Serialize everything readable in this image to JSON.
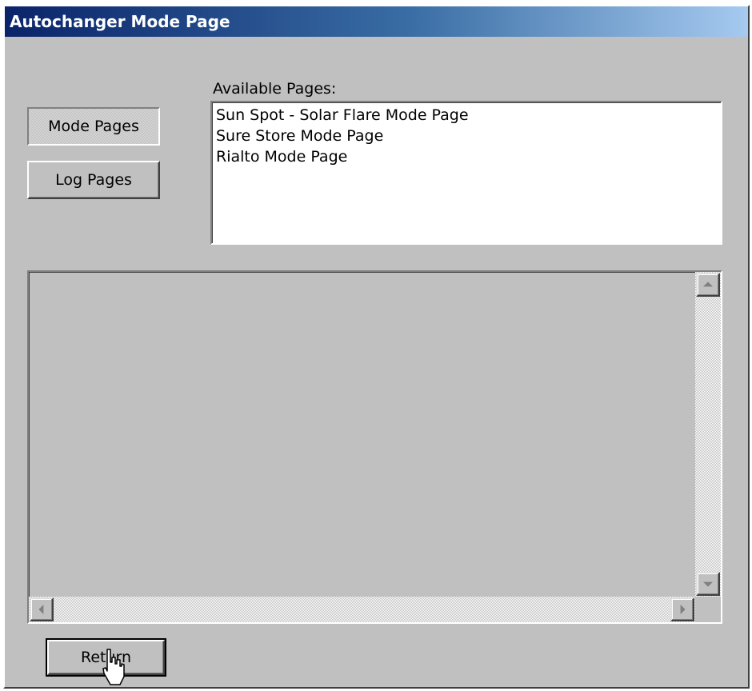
{
  "window": {
    "title": "Autochanger Mode Page"
  },
  "nav": {
    "mode_pages_label": "Mode Pages",
    "log_pages_label": "Log Pages",
    "active": "mode_pages"
  },
  "available_pages": {
    "label": "Available Pages:",
    "items": [
      "Sun Spot - Solar Flare Mode Page",
      "Sure Store Mode Page",
      "Rialto Mode Page"
    ]
  },
  "footer": {
    "return_label": "Return"
  },
  "icons": {
    "scroll_up": "scroll-up-arrow-icon",
    "scroll_down": "scroll-down-arrow-icon",
    "scroll_left": "scroll-left-arrow-icon",
    "scroll_right": "scroll-right-arrow-icon",
    "cursor": "hand-pointer-cursor-icon"
  },
  "colors": {
    "face": "#c0c0c0",
    "title_start": "#0a246a",
    "title_end": "#a6caf0"
  }
}
